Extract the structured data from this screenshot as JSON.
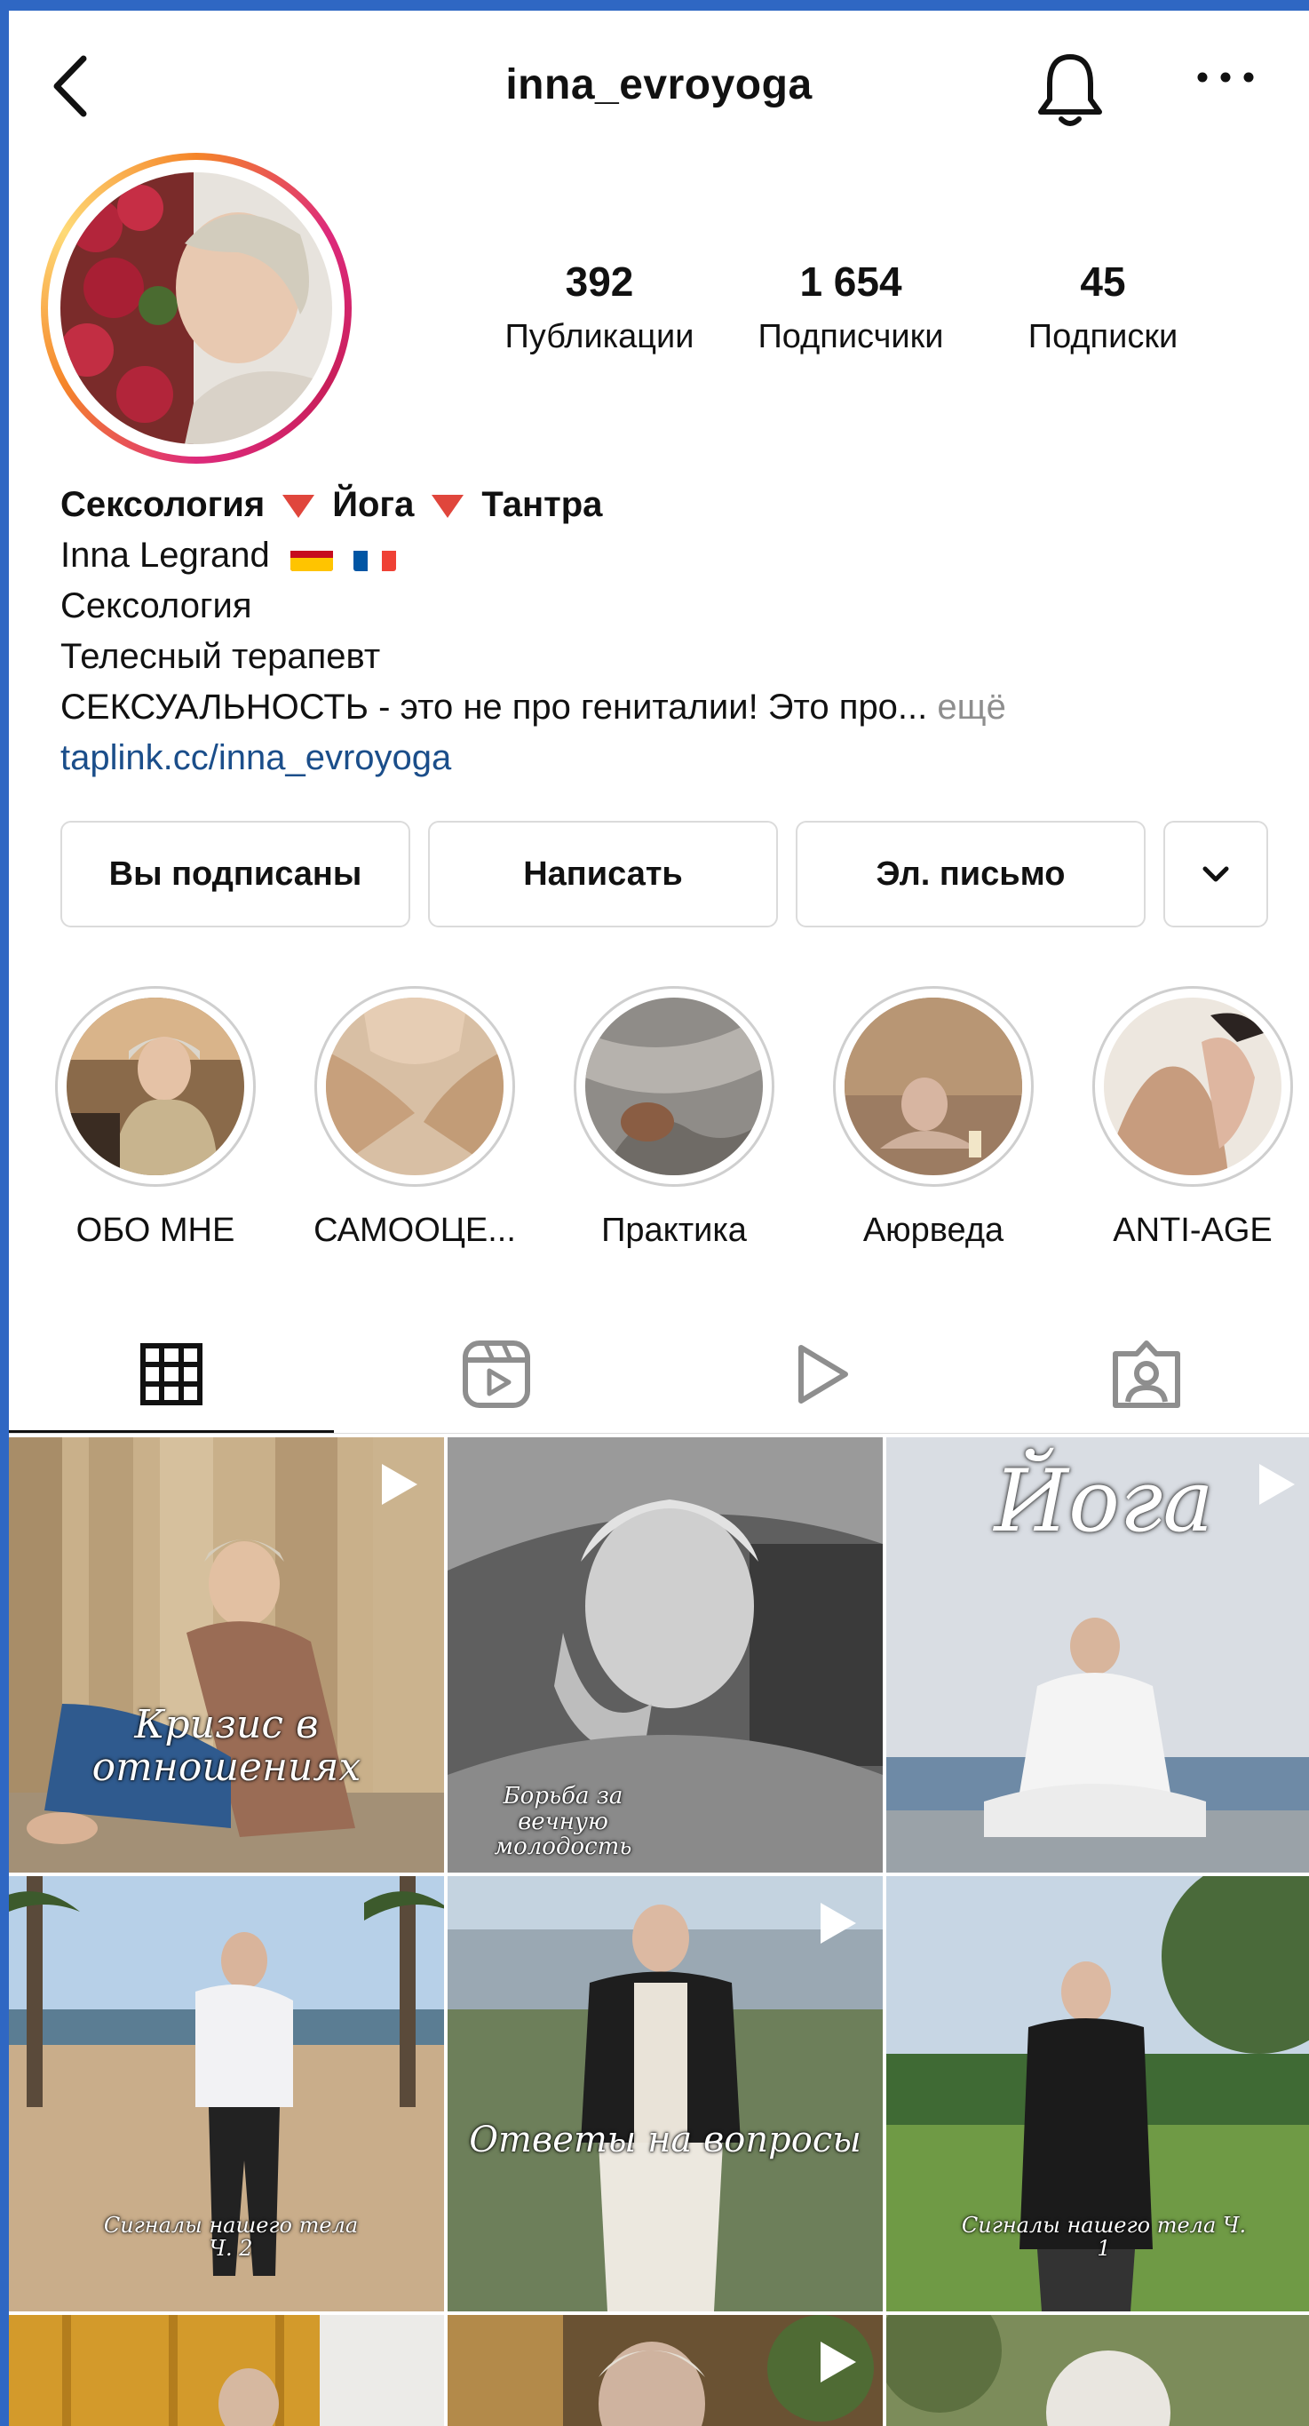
{
  "header": {
    "username": "inna_evroyoga",
    "back_icon": "chevron-left-icon",
    "bell_icon": "bell-icon",
    "more_icon": "more-horizontal-icon"
  },
  "stats": [
    {
      "value": "392",
      "label": "Публикации"
    },
    {
      "value": "1 654",
      "label": "Подписчики"
    },
    {
      "value": "45",
      "label": "Подписки"
    }
  ],
  "bio": {
    "headline_parts": [
      "Сексология",
      "Йога",
      "Тантра"
    ],
    "name": "Inna Legrand",
    "line1": "Сексология",
    "line2": "Телесный терапевт",
    "line3": "СЕКСУАЛЬНОСТЬ - это не про гениталии! Это про...",
    "more": "ещё",
    "link": "taplink.cc/inna_evroyoga"
  },
  "actions": {
    "following": "Вы подписаны",
    "message": "Написать",
    "email": "Эл. письмо"
  },
  "highlights": [
    {
      "label": "ОБО МНЕ"
    },
    {
      "label": "САМООЦЕ..."
    },
    {
      "label": "Практика"
    },
    {
      "label": "Аюрведа"
    },
    {
      "label": "ANTI-AGE"
    }
  ],
  "tabs": [
    "grid-icon",
    "reels-icon",
    "video-play-icon",
    "tagged-icon"
  ],
  "posts": [
    {
      "caption": "Кризис в отношениях"
    },
    {
      "caption": "Борьба за вечную молодость"
    },
    {
      "caption": "Йога"
    },
    {
      "caption": "Сигналы нашего тела Ч. 2"
    },
    {
      "caption": "Ответы на вопросы"
    },
    {
      "caption": "Сигналы нашего тела Ч. 1"
    }
  ],
  "colors": {
    "link": "#1b4e8a",
    "muted": "#8e8e8e",
    "border": "#dbdbdb",
    "frame": "#2f67c3"
  }
}
